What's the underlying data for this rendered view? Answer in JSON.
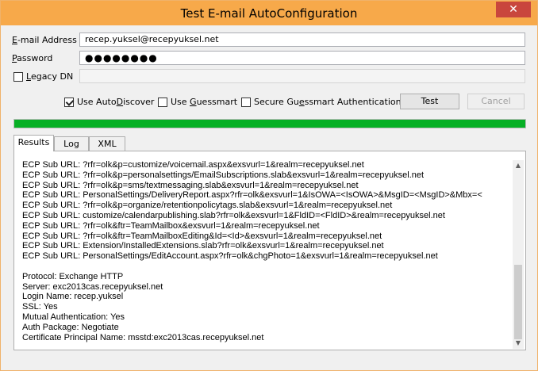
{
  "window": {
    "title": "Test E-mail AutoConfiguration",
    "close_glyph": "✕"
  },
  "form": {
    "email_label_accel": "E",
    "email_label_rest": "-mail Address",
    "email_value": "recep.yuksel@recepyuksel.net",
    "password_label_accel": "P",
    "password_label_rest": "assword",
    "password_value": "●●●●●●●●",
    "legacy_dn_label_accel": "L",
    "legacy_dn_label_rest": "egacy DN",
    "legacy_dn_checked": false,
    "legacy_dn_value": ""
  },
  "options": {
    "autodiscover": {
      "label_pre": "Use Auto",
      "label_accel": "D",
      "label_post": "iscover",
      "checked": true
    },
    "guessmart": {
      "label_pre": "Use ",
      "label_accel": "G",
      "label_post": "uessmart",
      "checked": false
    },
    "secure_guessmart": {
      "label_pre": "Secure Gu",
      "label_accel": "e",
      "label_post": "ssmart Authentication",
      "checked": false
    }
  },
  "buttons": {
    "test": "Test",
    "cancel": "Cancel"
  },
  "progress": {
    "percent": 100,
    "color": "#06b025"
  },
  "tabs": [
    {
      "label": "Results"
    },
    {
      "label": "Log"
    },
    {
      "label": "XML"
    }
  ],
  "results_lines": [
    "ECP Sub URL: ?rfr=olk&p=customize/voicemail.aspx&exsvurl=1&realm=recepyuksel.net",
    "ECP Sub URL: ?rfr=olk&p=personalsettings/EmailSubscriptions.slab&exsvurl=1&realm=recepyuksel.net",
    "ECP Sub URL: ?rfr=olk&p=sms/textmessaging.slab&exsvurl=1&realm=recepyuksel.net",
    "ECP Sub URL: PersonalSettings/DeliveryReport.aspx?rfr=olk&exsvurl=1&IsOWA=<IsOWA>&MsgID=<MsgID>&Mbx=<",
    "ECP Sub URL: ?rfr=olk&p=organize/retentionpolicytags.slab&exsvurl=1&realm=recepyuksel.net",
    "ECP Sub URL: customize/calendarpublishing.slab?rfr=olk&exsvurl=1&FldID=<FldID>&realm=recepyuksel.net",
    "ECP Sub URL: ?rfr=olk&ftr=TeamMailbox&exsvurl=1&realm=recepyuksel.net",
    "ECP Sub URL: ?rfr=olk&ftr=TeamMailboxEditing&Id=<Id>&exsvurl=1&realm=recepyuksel.net",
    "ECP Sub URL: Extension/InstalledExtensions.slab?rfr=olk&exsvurl=1&realm=recepyuksel.net",
    "ECP Sub URL: PersonalSettings/EditAccount.aspx?rfr=olk&chgPhoto=1&exsvurl=1&realm=recepyuksel.net",
    "",
    "Protocol: Exchange HTTP",
    "Server: exc2013cas.recepyuksel.net",
    "Login Name: recep.yuksel",
    "SSL: Yes",
    "Mutual Authentication: Yes",
    "Auth Package: Negotiate",
    "Certificate Principal Name: msstd:exc2013cas.recepyuksel.net"
  ]
}
